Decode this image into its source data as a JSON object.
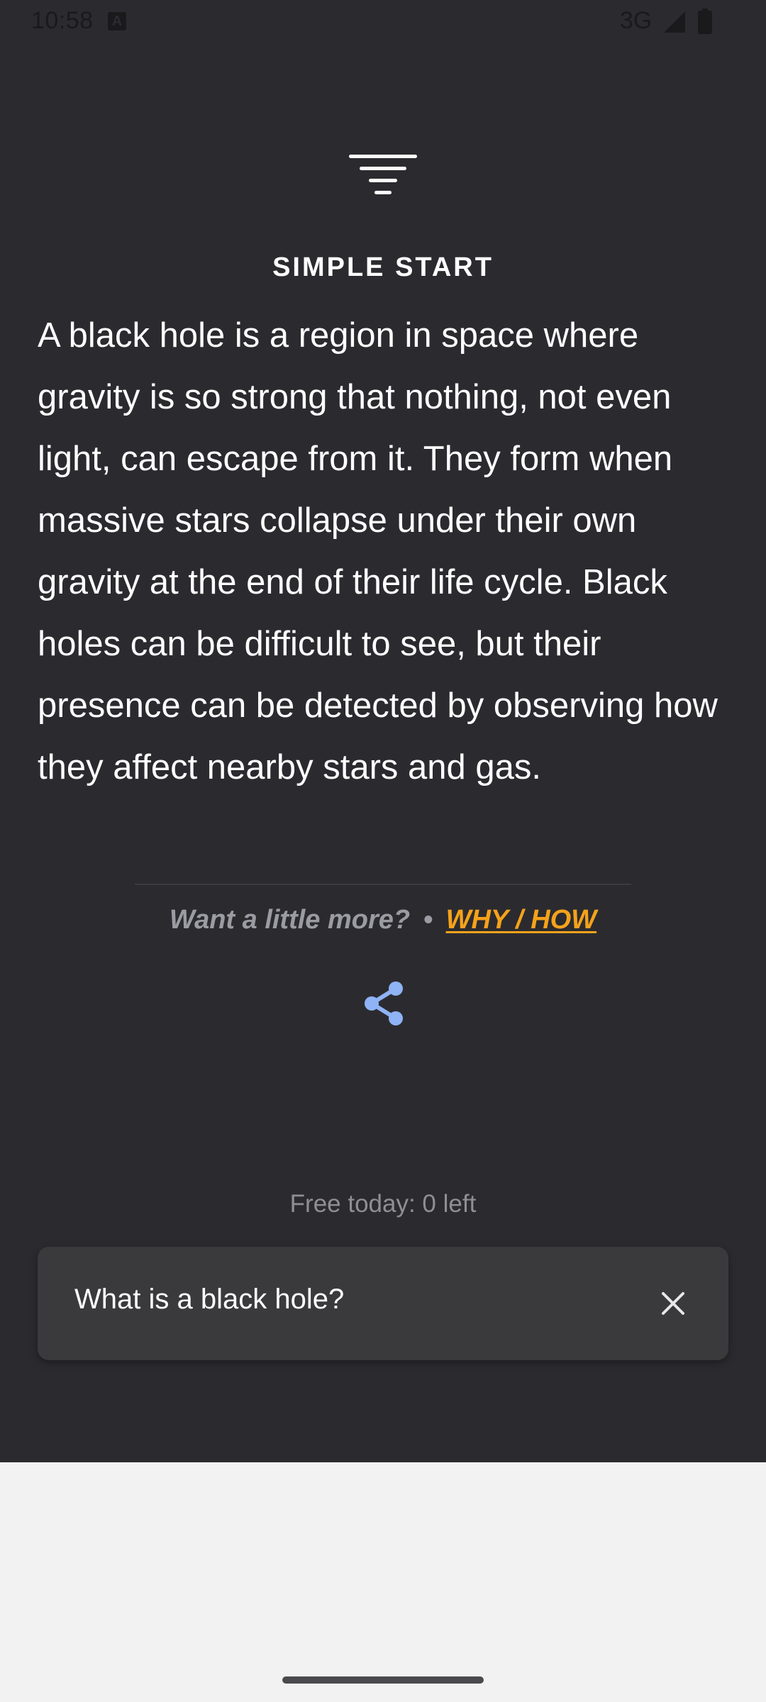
{
  "status_bar": {
    "time": "10:58",
    "notification_icon": "a-box-icon",
    "network": "3G",
    "signal_icon": "signal-icon",
    "battery_icon": "battery-icon"
  },
  "header": {
    "logo_icon": "funnel-lines-icon",
    "section_title": "SIMPLE START"
  },
  "answer": {
    "text": "A black hole is a region in space where gravity is so strong that nothing, not even light, can escape from it. They form when massive stars collapse under their own gravity at the end of their life cycle. Black holes can be difficult to see, but their presence can be detected by observing how they affect nearby stars and gas."
  },
  "more": {
    "prompt": "Want a little more?",
    "separator": "•",
    "link_label": "WHY / HOW"
  },
  "share": {
    "icon": "share-icon"
  },
  "quota": {
    "label": "Free today: 0 left"
  },
  "query": {
    "value": "What is a black hole?",
    "clear_icon": "close-icon"
  },
  "colors": {
    "background": "#2b2b2f",
    "accent_link": "#f5a21b",
    "share_icon": "#8fb3f5",
    "query_box": "#3a3a3d",
    "bottom_area": "#f2f2f2"
  }
}
